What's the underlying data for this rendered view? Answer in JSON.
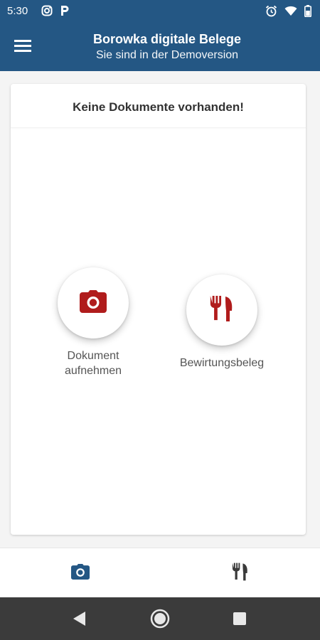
{
  "status_bar": {
    "time": "5:30",
    "icons": [
      "instagram-icon",
      "p-app-icon",
      "alarm-icon",
      "wifi-icon",
      "battery-icon"
    ]
  },
  "app_bar": {
    "title": "Borowka digitale Belege",
    "subtitle": "Sie sind in der Demoversion",
    "menu_icon": "hamburger-menu-icon"
  },
  "card": {
    "title": "Keine Dokumente vorhanden!",
    "actions": [
      {
        "label_line1": "Dokument",
        "label_line2": "aufnehmen",
        "icon": "camera-icon"
      },
      {
        "label_line1": "Bewirtungsbeleg",
        "icon": "cutlery-icon"
      }
    ]
  },
  "bottom_nav": {
    "items": [
      {
        "icon": "camera-icon",
        "active": true
      },
      {
        "icon": "cutlery-icon",
        "active": false
      }
    ]
  },
  "system_nav": {
    "buttons": [
      "back-icon",
      "home-icon",
      "recents-icon"
    ]
  },
  "colors": {
    "primary": "#245784",
    "accent_red": "#b01c1c",
    "dark_icon": "#3a3a3a"
  }
}
